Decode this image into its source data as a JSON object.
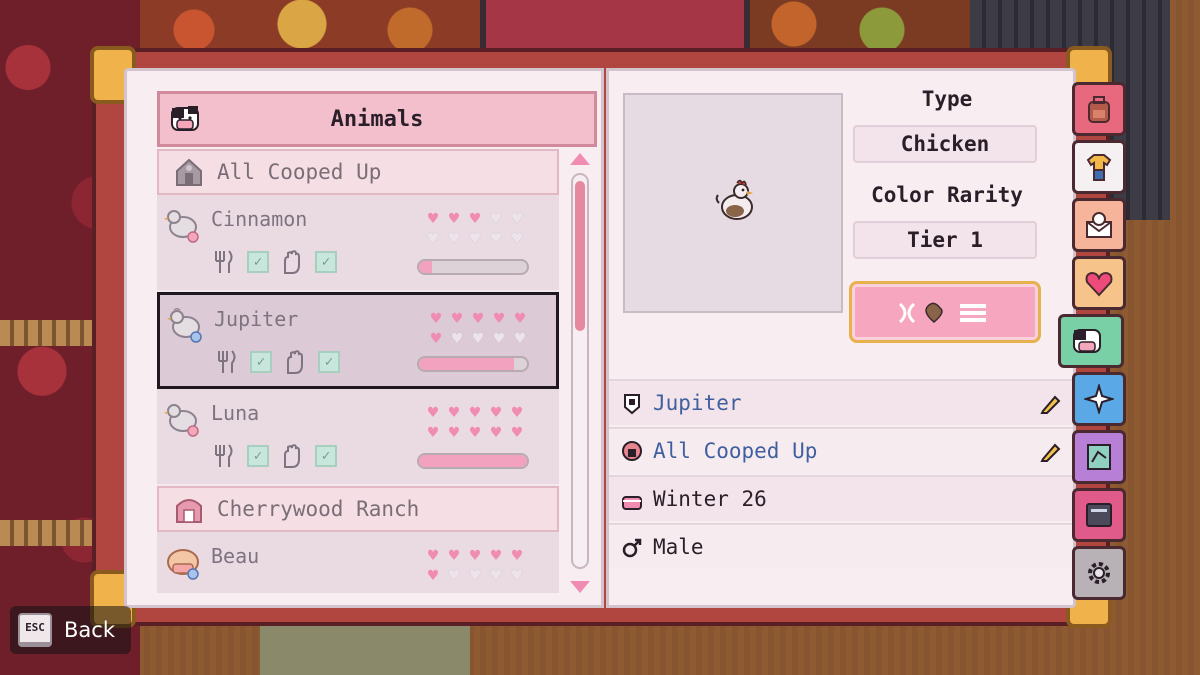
{
  "left_page": {
    "title": "Animals",
    "title_icon": "cow-face-icon",
    "groups": [
      {
        "label": "All Cooped Up",
        "icon": "coop-icon"
      },
      {
        "label": "Cherrywood Ranch",
        "icon": "barn-icon"
      }
    ],
    "animals": [
      {
        "name": "Cinnamon",
        "icon": "chicken-female-icon",
        "hearts_filled": 3,
        "hearts_total": 10,
        "fed": true,
        "petted": true,
        "progress": 0.12
      },
      {
        "name": "Jupiter",
        "icon": "chicken-male-icon",
        "hearts_filled": 6,
        "hearts_total": 10,
        "fed": true,
        "petted": true,
        "progress": 0.88,
        "selected": true
      },
      {
        "name": "Luna",
        "icon": "chicken-female-icon",
        "hearts_filled": 10,
        "hearts_total": 10,
        "fed": true,
        "petted": true,
        "progress": 1.0
      },
      {
        "name": "Beau",
        "icon": "cow-male-icon",
        "hearts_filled": 6,
        "hearts_total": 10
      }
    ],
    "check_mark": "✓"
  },
  "right_page": {
    "type_label": "Type",
    "type_value": "Chicken",
    "rarity_label": "Color Rarity",
    "rarity_value": "Tier 1",
    "action_button_icon": "dna-heart-list-icon",
    "rows": {
      "name": {
        "text": "Jupiter",
        "icon": "tag-icon",
        "editable": true
      },
      "home": {
        "text": "All Cooped Up",
        "icon": "coop-icon",
        "editable": true
      },
      "birthday": {
        "text": "Winter 26",
        "icon": "cake-icon"
      },
      "sex": {
        "text": "Male",
        "icon": "male-symbol-icon"
      }
    }
  },
  "tabs": [
    {
      "name": "backpack",
      "color": "#e8697e",
      "icon": "backpack-icon"
    },
    {
      "name": "clothing",
      "color": "#f5f0f2",
      "icon": "shirt-icon"
    },
    {
      "name": "mail",
      "color": "#f6b49a",
      "icon": "envelope-icon"
    },
    {
      "name": "relationships",
      "color": "#f6c48a",
      "icon": "heart-icon"
    },
    {
      "name": "animals",
      "color": "#7ad0a6",
      "icon": "cow-face-icon",
      "active": true
    },
    {
      "name": "skills",
      "color": "#5aa8e6",
      "icon": "sparkle-icon"
    },
    {
      "name": "map",
      "color": "#b77fd6",
      "icon": "map-icon"
    },
    {
      "name": "journal",
      "color": "#e05a8a",
      "icon": "book-icon"
    },
    {
      "name": "settings",
      "color": "#b8b2b6",
      "icon": "gear-icon"
    }
  ],
  "footer": {
    "key_label": "ESC",
    "back_label": "Back"
  },
  "colors": {
    "heart_on": "#f08cb2",
    "heart_off": "#ece4ea",
    "header_bg": "#f4bfcc",
    "link_text": "#3f5f9e",
    "book_cover": "#b0463f"
  }
}
